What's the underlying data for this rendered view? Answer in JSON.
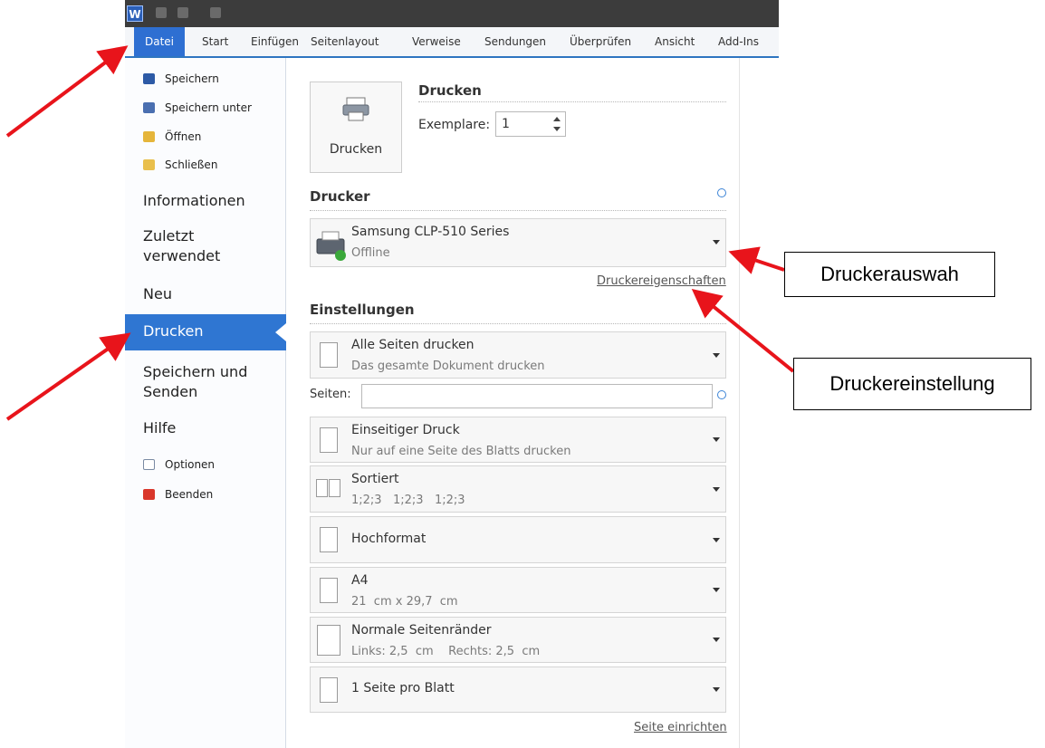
{
  "ribbon": {
    "tabs": [
      "Datei",
      "Start",
      "Einfügen",
      "Seitenlayout",
      "Verweise",
      "Sendungen",
      "Überprüfen",
      "Ansicht",
      "Add-Ins"
    ],
    "active_tab": "Datei"
  },
  "sidebar": {
    "small_items": [
      "Speichern",
      "Speichern unter",
      "Öffnen",
      "Schließen"
    ],
    "informationen": "Informationen",
    "zuletzt_1": "Zuletzt",
    "zuletzt_2": "verwendet",
    "neu": "Neu",
    "drucken": "Drucken",
    "speichern_senden_1": "Speichern und",
    "speichern_senden_2": "Senden",
    "hilfe": "Hilfe",
    "optionen": "Optionen",
    "beenden": "Beenden"
  },
  "print": {
    "button_label": "Drucken",
    "header": "Drucken",
    "copies_label": "Exemplare:",
    "copies_value": "1"
  },
  "printer": {
    "header": "Drucker",
    "name": "Samsung CLP-510 Series",
    "status": "Offline",
    "properties_link": "Druckereigenschaften"
  },
  "settings": {
    "header": "Einstellungen",
    "range_title": "Alle Seiten drucken",
    "range_sub": "Das gesamte Dokument drucken",
    "pages_label": "Seiten:",
    "pages_value": "",
    "sides_title": "Einseitiger Druck",
    "sides_sub": "Nur auf eine Seite des Blatts drucken",
    "collate_title": "Sortiert",
    "collate_sub": "1;2;3   1;2;3   1;2;3",
    "orientation": "Hochformat",
    "paper_title": "A4",
    "paper_sub": "21  cm x 29,7  cm",
    "margins_title": "Normale Seitenränder",
    "margins_sub": "Links: 2,5  cm    Rechts: 2,5  cm",
    "pages_per_sheet": "1 Seite pro Blatt",
    "page_setup_link": "Seite einrichten"
  },
  "callouts": {
    "printer_select": "Druckerauswah",
    "printer_settings": "Druckereinstellung"
  },
  "colors": {
    "accent": "#2f76d2",
    "arrow": "#e8141b"
  }
}
